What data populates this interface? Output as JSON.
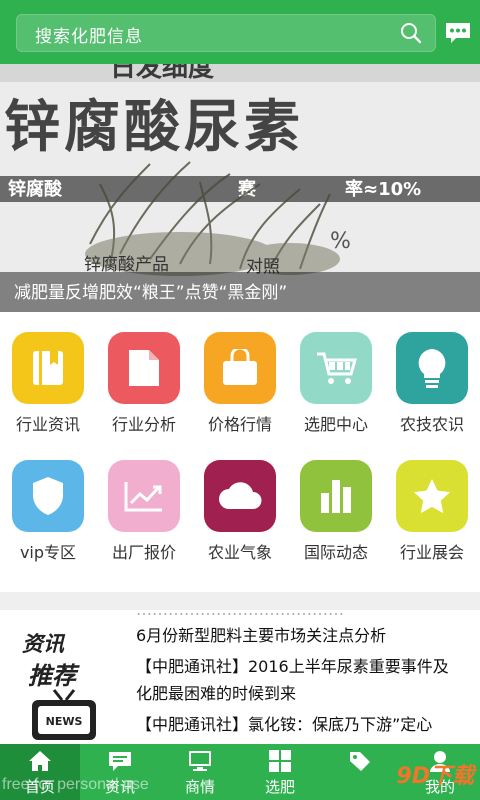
{
  "header": {
    "search_placeholder": "搜索化肥信息",
    "accent": "#2fb150"
  },
  "banner": {
    "image_lines": [
      "日发细度",
      "锌腐酸尿素",
      "锌腐酸",
      "赛",
      "率≈10%",
      "锌腐酸产品",
      "对照"
    ],
    "caption": "减肥量反增肥效“粮王”点赞“黑金刚”"
  },
  "categories": [
    {
      "label": "行业资讯",
      "icon": "book-icon",
      "color": "#f5c61a"
    },
    {
      "label": "行业分析",
      "icon": "document-icon",
      "color": "#ec5a5f"
    },
    {
      "label": "价格行情",
      "icon": "bag-icon",
      "color": "#f6a623"
    },
    {
      "label": "选肥中心",
      "icon": "cart-icon",
      "color": "#93d9c8"
    },
    {
      "label": "农技农识",
      "icon": "bulb-icon",
      "color": "#2fa39e"
    },
    {
      "label": "vip专区",
      "icon": "shield-icon",
      "color": "#5cb6e7"
    },
    {
      "label": "出厂报价",
      "icon": "trend-icon",
      "color": "#f1aecf"
    },
    {
      "label": "农业气象",
      "icon": "cloud-icon",
      "color": "#a0204f"
    },
    {
      "label": "国际动态",
      "icon": "bar-chart-icon",
      "color": "#90c23e"
    },
    {
      "label": "行业展会",
      "icon": "star-icon",
      "color": "#d9e031"
    }
  ],
  "news": {
    "badge_line1": "资讯",
    "badge_line2": "推荐",
    "tv_label": "NEWS",
    "items": [
      "6月份新型肥料主要市场关注点分析",
      "【中肥通讯社】2016上半年尿素重要事件及",
      "化肥最困难的时候到来",
      "【中肥通讯社】氯化铵：保底乃下游”定心"
    ]
  },
  "tabs": [
    {
      "label": "首页",
      "icon": "home-icon",
      "active": true
    },
    {
      "label": "资讯",
      "icon": "message-icon",
      "active": false
    },
    {
      "label": "商情",
      "icon": "monitor-icon",
      "active": false
    },
    {
      "label": "选肥",
      "icon": "grid-icon",
      "active": false
    },
    {
      "label": "",
      "icon": "tag-icon",
      "active": false
    },
    {
      "label": "我的",
      "icon": "user-icon",
      "active": false
    }
  ],
  "watermarks": {
    "left": "free for personal use",
    "right": "9D下载"
  }
}
